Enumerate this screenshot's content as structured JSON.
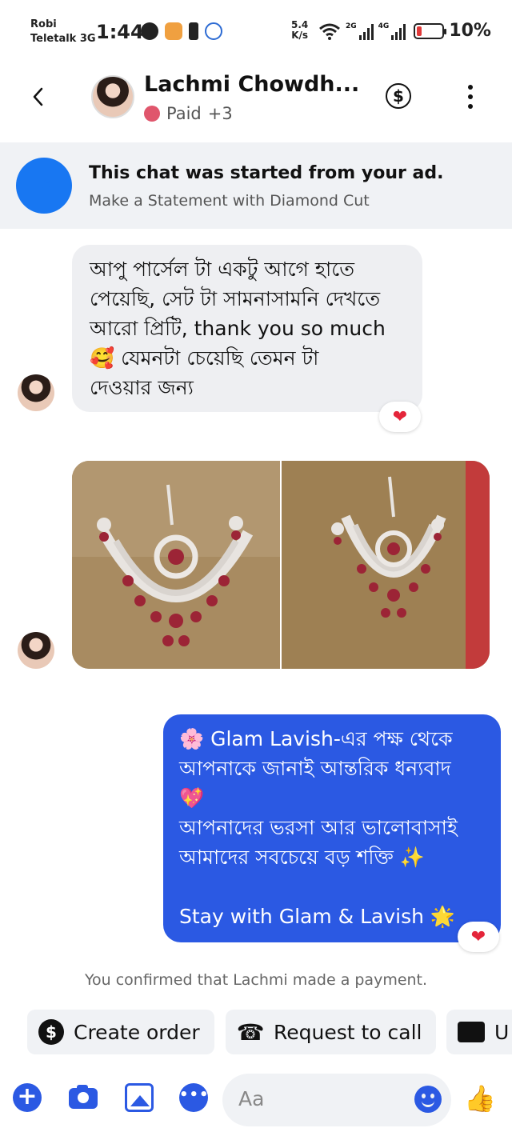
{
  "status_bar": {
    "carrier_1": "Robi",
    "carrier_2": "Teletalk 3G",
    "time": "1:44",
    "net_speed_value": "5.4",
    "net_speed_unit": "K/s",
    "sim1_tech": "2G",
    "sim2_tech": "4G",
    "battery_percent": "10%"
  },
  "header": {
    "contact_name": "Lachmi Chowdh...",
    "label": "Paid",
    "label_extra": "+3",
    "label_color": "#e0566c",
    "payment_icon": "dollar-circle-icon",
    "more_icon": "more-vertical-icon"
  },
  "ad_banner": {
    "title": "This chat was started from your ad.",
    "subtitle": "Make a Statement with Diamond Cut",
    "icon": "facebook-icon",
    "icon_color": "#1877f2"
  },
  "messages": [
    {
      "direction": "incoming",
      "lines": [
        "আপু পার্সেল টা একটু আগে হাতে",
        "পেয়েছি, সেট টা সামনাসামনি দেখতে",
        "আরো প্রিটি, thank you so much",
        "🥰  যেমনটা চেয়েছি তেমন টা",
        "দেওয়ার জন্য"
      ],
      "reaction": "❤"
    },
    {
      "direction": "incoming",
      "type": "photos",
      "count": 2
    },
    {
      "direction": "outgoing",
      "lines": [
        "🌸 Glam  Lavish-এর পক্ষ থেকে",
        "আপনাকে জানাই আন্তরিক ধন্যবাদ",
        "💖",
        "আপনাদের ভরসা আর ভালোবাসাই",
        "আমাদের সবচেয়ে বড় শক্তি ✨",
        "",
        "Stay with Glam & Lavish 🌟"
      ],
      "reaction": "❤",
      "bubble_color": "#2b59e3"
    }
  ],
  "system_message": "You confirmed that Lachmi made a payment.",
  "quick_actions": [
    {
      "label": "Create order",
      "icon": "dollar-circle-icon"
    },
    {
      "label": "Request to call",
      "icon": "phone-add-icon"
    },
    {
      "label": "U",
      "icon": "contact-card-icon"
    }
  ],
  "composer": {
    "placeholder": "Aa",
    "icons": [
      "plus-icon",
      "camera-icon",
      "gallery-icon",
      "chat-bubble-icon",
      "emoji-icon",
      "thumbs-up-icon"
    ],
    "accent": "#2b59e3"
  }
}
